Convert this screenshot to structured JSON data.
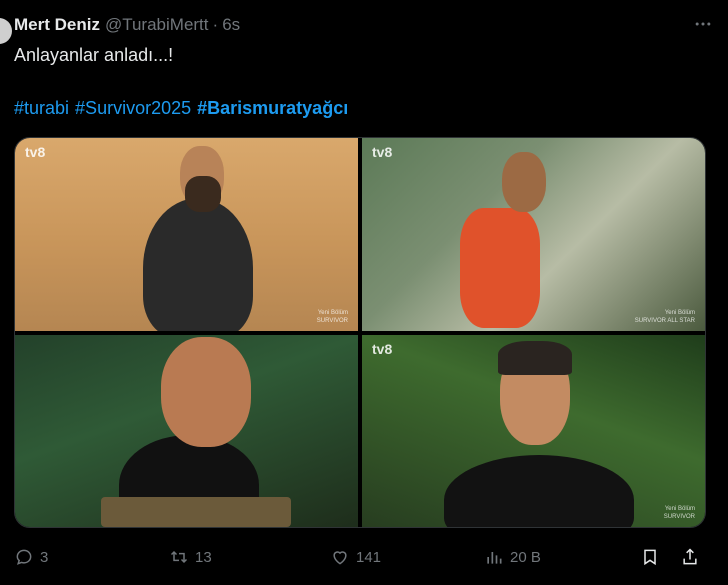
{
  "post": {
    "author_name": "Mert Deniz",
    "author_handle": "@TurabiMertt",
    "separator": "·",
    "time": "6s",
    "text": "Anlayanlar anladı...!",
    "hashtags": [
      "#turabi",
      "#Survivor2025",
      "#Barismuratyağcı"
    ]
  },
  "media": {
    "logo": "tv8",
    "watermark_line1": "Yeni Bölüm",
    "watermark_line2": "SURVIVOR",
    "watermark_line3": "SURVIVOR ALL STAR"
  },
  "actions": {
    "reply_count": "3",
    "retweet_count": "13",
    "like_count": "141",
    "views_count": "20 B"
  },
  "icons": [
    "more-icon",
    "reply-icon",
    "retweet-icon",
    "like-icon",
    "views-icon",
    "bookmark-icon",
    "share-icon"
  ],
  "colors": {
    "background": "#000000",
    "text": "#e7e9ea",
    "muted": "#71767b",
    "link": "#1d9bf0"
  }
}
